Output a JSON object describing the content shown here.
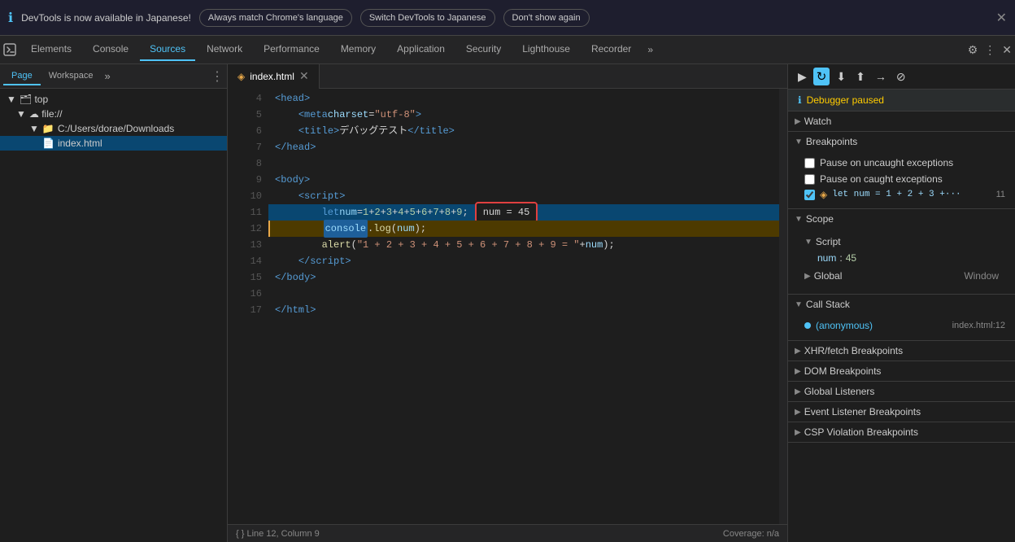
{
  "notification": {
    "icon": "ℹ",
    "text": "DevTools is now available in Japanese!",
    "btn1": "Always match Chrome's language",
    "btn2": "Switch DevTools to Japanese",
    "btn3": "Don't show again",
    "close": "✕"
  },
  "tabs": {
    "items": [
      {
        "label": "Elements",
        "active": false
      },
      {
        "label": "Console",
        "active": false
      },
      {
        "label": "Sources",
        "active": true
      },
      {
        "label": "Network",
        "active": false
      },
      {
        "label": "Performance",
        "active": false
      },
      {
        "label": "Memory",
        "active": false
      },
      {
        "label": "Application",
        "active": false
      },
      {
        "label": "Security",
        "active": false
      },
      {
        "label": "Lighthouse",
        "active": false
      },
      {
        "label": "Recorder",
        "active": false
      }
    ],
    "more": "»",
    "settings_icon": "⚙",
    "menu_icon": "⋮",
    "close_icon": "✕"
  },
  "file_panel": {
    "tab_page": "Page",
    "tab_workspace": "Workspace",
    "tab_more": "»",
    "tree": [
      {
        "indent": 0,
        "icon": "▼",
        "label": "top",
        "type": "root"
      },
      {
        "indent": 1,
        "icon": "▼",
        "label": "file://",
        "type": "origin"
      },
      {
        "indent": 2,
        "icon": "▼",
        "label": "C:/Users/dorae/Downloads",
        "type": "folder"
      },
      {
        "indent": 3,
        "icon": "📄",
        "label": "index.html",
        "type": "file",
        "selected": true
      }
    ]
  },
  "editor": {
    "tab_label": "index.html",
    "tab_icon": "◈",
    "lines": [
      {
        "num": 4,
        "code_html": "<span class='tag'>&lt;head&gt;</span>",
        "highlight": false,
        "paused": false
      },
      {
        "num": 5,
        "code_html": "    <span class='tag'>&lt;meta</span> <span class='attr'>charset</span>=<span class='val'>\"utf-8\"</span><span class='tag'>&gt;</span>",
        "highlight": false,
        "paused": false
      },
      {
        "num": 6,
        "code_html": "    <span class='tag'>&lt;title&gt;</span><span class='str'>デバッグテスト</span><span class='tag'>&lt;/title&gt;</span>",
        "highlight": false,
        "paused": false
      },
      {
        "num": 7,
        "code_html": "<span class='tag'>&lt;/head&gt;</span>",
        "highlight": false,
        "paused": false
      },
      {
        "num": 8,
        "code_html": "",
        "highlight": false,
        "paused": false
      },
      {
        "num": 9,
        "code_html": "<span class='tag'>&lt;body&gt;</span>",
        "highlight": false,
        "paused": false
      },
      {
        "num": 10,
        "code_html": "    <span class='tag'>&lt;script&gt;</span>",
        "highlight": false,
        "paused": false
      },
      {
        "num": 11,
        "code_html": "        <span class='kw'>let</span> <span class='var-name'>num</span> <span class='op'>=</span> <span class='num'>1</span> <span class='op'>+</span> <span class='num'>2</span> <span class='op'>+</span> <span class='num'>3</span> <span class='op'>+</span> <span class='num'>4</span> <span class='op'>+</span> <span class='num'>5</span> <span class='op'>+</span> <span class='num'>6</span> <span class='op'>+</span> <span class='num'>7</span> <span class='op'>+</span> <span class='num'>8</span> <span class='op'>+</span> <span class='num'>9</span><span class='punct'>;</span>",
        "highlight": true,
        "paused": false,
        "tooltip": "num = 45"
      },
      {
        "num": 12,
        "code_html": "        <span class='fn'>console</span><span class='punct'>.</span><span class='fn'>log</span><span class='punct'>(</span><span class='var-name'>num</span><span class='punct'>);</span>",
        "highlight": false,
        "paused": true
      },
      {
        "num": 13,
        "code_html": "        <span class='fn'>alert</span><span class='punct'>(</span><span class='str'>\"1 + 2 + 3 + 4 + 5 + 6 + 7 + 8 + 9 = \"</span> <span class='op'>+</span> <span class='var-name'>num</span><span class='punct'>);</span>",
        "highlight": false,
        "paused": false
      },
      {
        "num": 14,
        "code_html": "    <span class='tag'>&lt;/script&gt;</span>",
        "highlight": false,
        "paused": false
      },
      {
        "num": 15,
        "code_html": "<span class='tag'>&lt;/body&gt;</span>",
        "highlight": false,
        "paused": false
      },
      {
        "num": 16,
        "code_html": "",
        "highlight": false,
        "paused": false
      },
      {
        "num": 17,
        "code_html": "<span class='tag'>&lt;/html&gt;</span>",
        "highlight": false,
        "paused": false
      }
    ]
  },
  "debug_panel": {
    "debugger_paused": "Debugger paused",
    "watch_label": "Watch",
    "breakpoints_label": "Breakpoints",
    "pause_uncaught": "Pause on uncaught exceptions",
    "pause_caught": "Pause on caught exceptions",
    "bp_file": "index.html",
    "bp_code": "let num = 1 + 2 + 3 +···",
    "bp_line": "11",
    "scope_label": "Scope",
    "script_label": "Script",
    "scope_key": "num",
    "scope_val": "45",
    "global_label": "Global",
    "global_val": "Window",
    "callstack_label": "Call Stack",
    "callstack_fn": "(anonymous)",
    "callstack_file": "index.html:12",
    "xhr_label": "XHR/fetch Breakpoints",
    "dom_label": "DOM Breakpoints",
    "listeners_label": "Global Listeners",
    "event_label": "Event Listener Breakpoints",
    "csp_label": "CSP Violation Breakpoints"
  },
  "status_bar": {
    "left": "{ }  Line 12, Column 9",
    "right": "Coverage: n/a"
  },
  "toolbar": {
    "resume_icon": "▶",
    "step_over_icon": "↷",
    "step_into_icon": "↓",
    "step_out_icon": "↑",
    "step_icon": "→",
    "deactivate_icon": "⊘"
  }
}
